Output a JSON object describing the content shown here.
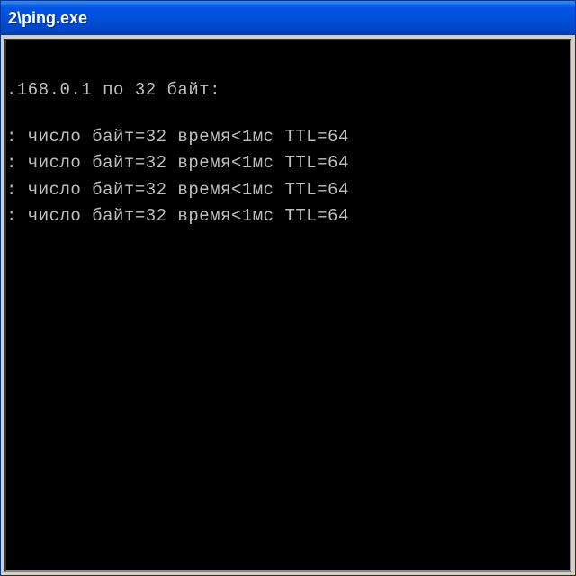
{
  "window": {
    "title": "2\\ping.exe"
  },
  "console": {
    "header": ".168.0.1 по 32 байт:",
    "lines": [
      ": число байт=32 время<1мс TTL=64",
      ": число байт=32 время<1мс TTL=64",
      ": число байт=32 время<1мс TTL=64",
      ": число байт=32 время<1мс TTL=64"
    ]
  }
}
